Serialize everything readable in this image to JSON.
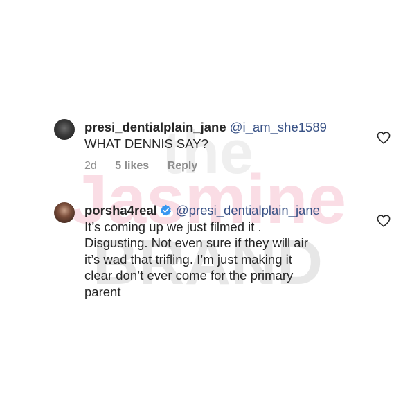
{
  "comments": [
    {
      "username": "presi_dentialplain_jane",
      "mention": "@i_am_she1589",
      "text": "WHAT DENNIS SAY?",
      "time": "2d",
      "likes": "5 likes",
      "reply": "Reply"
    },
    {
      "username": "porsha4real",
      "mention": "@presi_dentialplain_jane",
      "lines": [
        "It’s coming up we just filmed it .",
        "Disgusting. Not even sure if they will air",
        "it’s wad that trifling. I’m just making it",
        "clear don’t ever come for the primary",
        "parent"
      ]
    }
  ],
  "watermark": {
    "line1": "the",
    "line2": "Jasmine",
    "line3": "BRAND"
  },
  "icons": {
    "heart": "heart-outline-icon",
    "verified": "verified-badge-icon"
  },
  "colors": {
    "mention": "#385185",
    "verified": "#3897f0",
    "meta": "#8e8e8e",
    "watermark_pink": "#f4b6c6",
    "watermark_gray": "#cfcfcf"
  }
}
